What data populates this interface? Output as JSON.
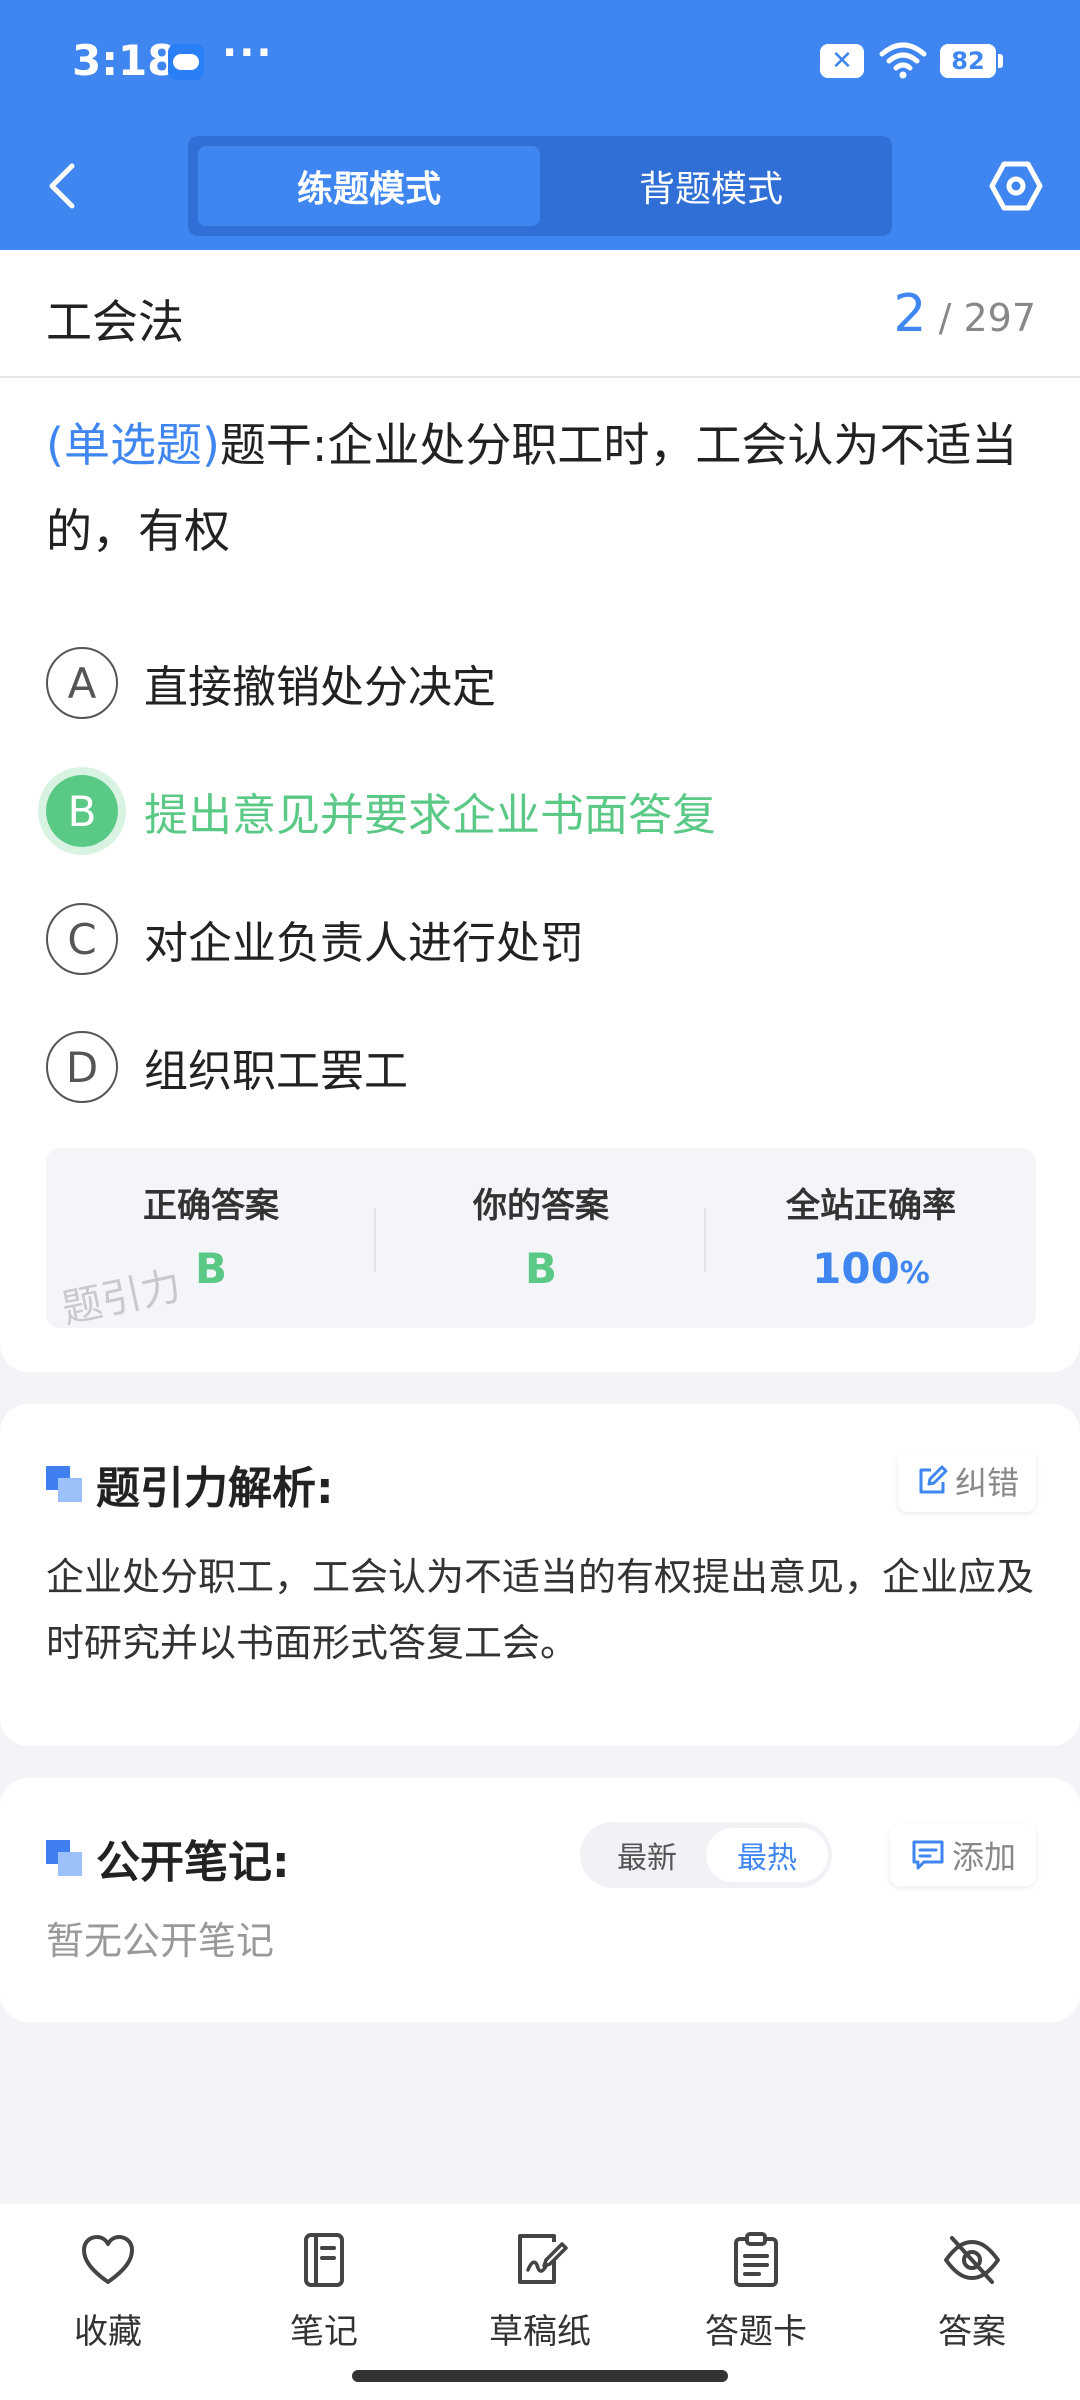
{
  "status_bar": {
    "time": "3:18",
    "dots": "···",
    "battery": "82"
  },
  "header": {
    "tabs": [
      {
        "label": "练题模式",
        "active": true
      },
      {
        "label": "背题模式",
        "active": false
      }
    ]
  },
  "question": {
    "subject": "工会法",
    "current": "2",
    "separator": "/",
    "total": "297",
    "type_label": "(单选题)",
    "stem": "题干:企业处分职工时，工会认为不适当的，有权",
    "options": [
      {
        "letter": "A",
        "text": "直接撤销处分决定"
      },
      {
        "letter": "B",
        "text": "提出意见并要求企业书面答复"
      },
      {
        "letter": "C",
        "text": "对企业负责人进行处罚"
      },
      {
        "letter": "D",
        "text": "组织职工罢工"
      }
    ]
  },
  "stats": {
    "correct_label": "正确答案",
    "correct_value": "B",
    "yours_label": "你的答案",
    "yours_value": "B",
    "rate_label": "全站正确率",
    "rate_value": "100",
    "rate_unit": "%",
    "watermark": "题引力"
  },
  "analysis": {
    "title": "题引力解析:",
    "report_label": "纠错",
    "text": "企业处分职工，工会认为不适当的有权提出意见，企业应及时研究并以书面形式答复工会。"
  },
  "notes": {
    "title": "公开笔记:",
    "sort_newest": "最新",
    "sort_hottest": "最热",
    "add_label": "添加",
    "empty_text": "暂无公开笔记"
  },
  "bottom_nav": {
    "favorite": "收藏",
    "notes": "笔记",
    "scratch": "草稿纸",
    "answer_sheet": "答题卡",
    "answer": "答案"
  },
  "colors": {
    "primary": "#3f86f0",
    "correct": "#5bc986"
  }
}
